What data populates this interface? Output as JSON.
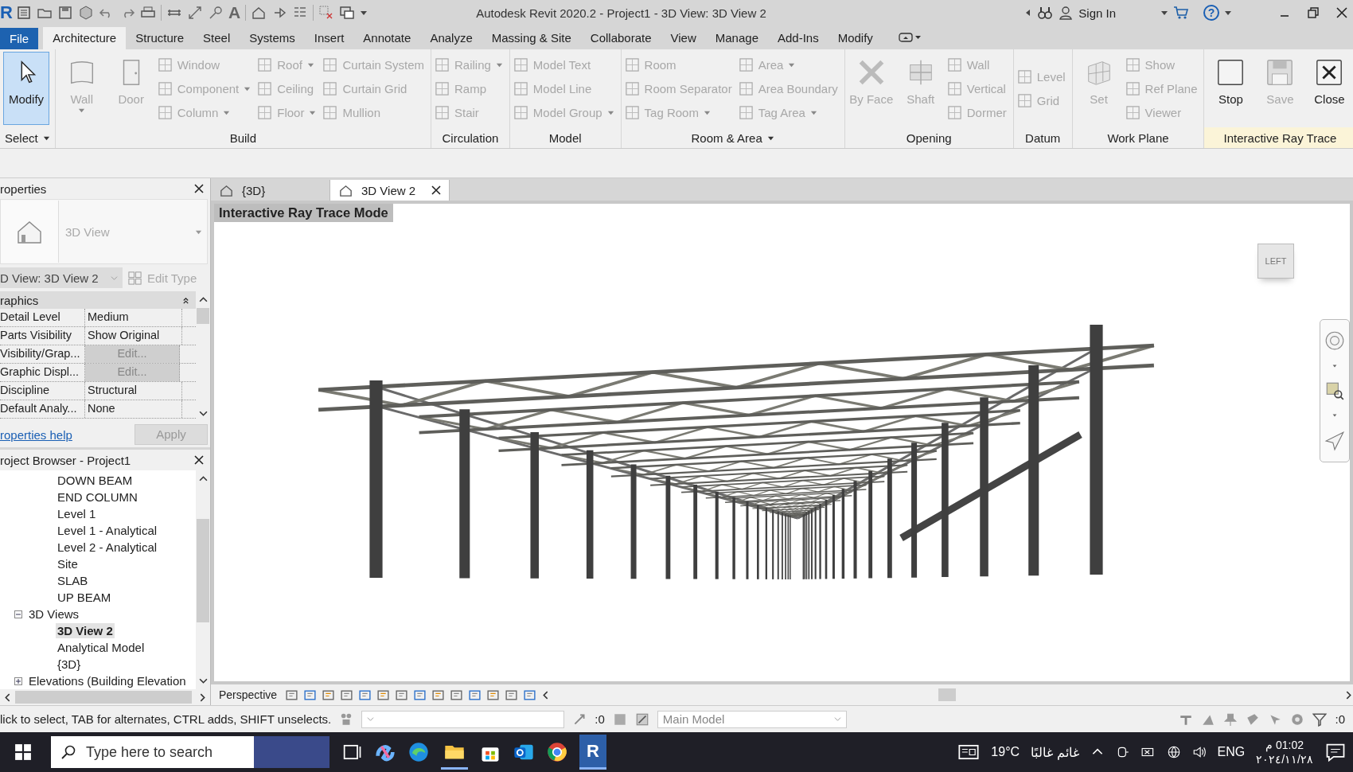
{
  "title_bar": {
    "logo": "R",
    "text_glyph": "A",
    "title": "Autodesk Revit 2020.2 - Project1 - 3D View: 3D View 2",
    "sign_in": "Sign In",
    "help_glyph": "?"
  },
  "ribbon_tabs": [
    {
      "label": "File",
      "kind": "file",
      "selected": false
    },
    {
      "label": "Architecture",
      "kind": "tab",
      "selected": true
    },
    {
      "label": "Structure",
      "kind": "tab",
      "selected": false
    },
    {
      "label": "Steel",
      "kind": "tab",
      "selected": false
    },
    {
      "label": "Systems",
      "kind": "tab",
      "selected": false
    },
    {
      "label": "Insert",
      "kind": "tab",
      "selected": false
    },
    {
      "label": "Annotate",
      "kind": "tab",
      "selected": false
    },
    {
      "label": "Analyze",
      "kind": "tab",
      "selected": false
    },
    {
      "label": "Massing & Site",
      "kind": "tab",
      "selected": false
    },
    {
      "label": "Collaborate",
      "kind": "tab",
      "selected": false
    },
    {
      "label": "View",
      "kind": "tab",
      "selected": false
    },
    {
      "label": "Manage",
      "kind": "tab",
      "selected": false
    },
    {
      "label": "Add-Ins",
      "kind": "tab",
      "selected": false
    },
    {
      "label": "Modify",
      "kind": "tab",
      "selected": false
    }
  ],
  "ribbon_panels": [
    {
      "title": "Select",
      "has_menu": true,
      "highlighted": false,
      "columns": [
        [
          {
            "label": "Modify",
            "kind": "large",
            "selected": true,
            "disabled": false,
            "has_menu": false
          }
        ]
      ]
    },
    {
      "title": "Build",
      "has_menu": false,
      "highlighted": false,
      "columns": [
        [
          {
            "label": "Wall",
            "kind": "large",
            "selected": false,
            "disabled": true,
            "has_menu": true
          }
        ],
        [
          {
            "label": "Door",
            "kind": "large",
            "selected": false,
            "disabled": true,
            "has_menu": false
          }
        ],
        [
          {
            "label": "Window",
            "kind": "small",
            "selected": false,
            "disabled": true,
            "has_menu": false
          },
          {
            "label": "Component",
            "kind": "small",
            "selected": false,
            "disabled": true,
            "has_menu": true
          },
          {
            "label": "Column",
            "kind": "small",
            "selected": false,
            "disabled": true,
            "has_menu": true
          }
        ],
        [
          {
            "label": "Roof",
            "kind": "small",
            "selected": false,
            "disabled": true,
            "has_menu": true
          },
          {
            "label": "Ceiling",
            "kind": "small",
            "selected": false,
            "disabled": true,
            "has_menu": false
          },
          {
            "label": "Floor",
            "kind": "small",
            "selected": false,
            "disabled": true,
            "has_menu": true
          }
        ],
        [
          {
            "label": "Curtain System",
            "kind": "small",
            "selected": false,
            "disabled": true,
            "has_menu": false
          },
          {
            "label": "Curtain Grid",
            "kind": "small",
            "selected": false,
            "disabled": true,
            "has_menu": false
          },
          {
            "label": "Mullion",
            "kind": "small",
            "selected": false,
            "disabled": true,
            "has_menu": false
          }
        ]
      ]
    },
    {
      "title": "Circulation",
      "has_menu": false,
      "highlighted": false,
      "columns": [
        [
          {
            "label": "Railing",
            "kind": "small",
            "selected": false,
            "disabled": true,
            "has_menu": true
          },
          {
            "label": "Ramp",
            "kind": "small",
            "selected": false,
            "disabled": true,
            "has_menu": false
          },
          {
            "label": "Stair",
            "kind": "small",
            "selected": false,
            "disabled": true,
            "has_menu": false
          }
        ]
      ]
    },
    {
      "title": "Model",
      "has_menu": false,
      "highlighted": false,
      "columns": [
        [
          {
            "label": "Model Text",
            "kind": "small",
            "selected": false,
            "disabled": true,
            "has_menu": false
          },
          {
            "label": "Model Line",
            "kind": "small",
            "selected": false,
            "disabled": true,
            "has_menu": false
          },
          {
            "label": "Model Group",
            "kind": "small",
            "selected": false,
            "disabled": true,
            "has_menu": true
          }
        ]
      ]
    },
    {
      "title": "Room & Area",
      "has_menu": true,
      "highlighted": false,
      "columns": [
        [
          {
            "label": "Room",
            "kind": "small",
            "selected": false,
            "disabled": true,
            "has_menu": false
          },
          {
            "label": "Room Separator",
            "kind": "small",
            "selected": false,
            "disabled": true,
            "has_menu": false
          },
          {
            "label": "Tag Room",
            "kind": "small",
            "selected": false,
            "disabled": true,
            "has_menu": true
          }
        ],
        [
          {
            "label": "Area",
            "kind": "small",
            "selected": false,
            "disabled": true,
            "has_menu": true
          },
          {
            "label": "Area Boundary",
            "kind": "small",
            "selected": false,
            "disabled": true,
            "has_menu": false
          },
          {
            "label": "Tag Area",
            "kind": "small",
            "selected": false,
            "disabled": true,
            "has_menu": true
          }
        ]
      ]
    },
    {
      "title": "Opening",
      "has_menu": false,
      "highlighted": false,
      "columns": [
        [
          {
            "label": "By Face",
            "kind": "large",
            "selected": false,
            "disabled": true,
            "has_menu": false
          }
        ],
        [
          {
            "label": "Shaft",
            "kind": "large",
            "selected": false,
            "disabled": true,
            "has_menu": false
          }
        ],
        [
          {
            "label": "Wall",
            "kind": "small",
            "selected": false,
            "disabled": true,
            "has_menu": false
          },
          {
            "label": "Vertical",
            "kind": "small",
            "selected": false,
            "disabled": true,
            "has_menu": false
          },
          {
            "label": "Dormer",
            "kind": "small",
            "selected": false,
            "disabled": true,
            "has_menu": false
          }
        ]
      ]
    },
    {
      "title": "Datum",
      "has_menu": false,
      "highlighted": false,
      "columns": [
        [
          {
            "label": "Level",
            "kind": "small",
            "selected": false,
            "disabled": true,
            "has_menu": false
          },
          {
            "label": "Grid",
            "kind": "small",
            "selected": false,
            "disabled": true,
            "has_menu": false
          }
        ]
      ]
    },
    {
      "title": "Work Plane",
      "has_menu": false,
      "highlighted": false,
      "columns": [
        [
          {
            "label": "Set",
            "kind": "large",
            "selected": false,
            "disabled": true,
            "has_menu": false
          }
        ],
        [
          {
            "label": "Show",
            "kind": "small",
            "selected": false,
            "disabled": true,
            "has_menu": false
          },
          {
            "label": "Ref Plane",
            "kind": "small",
            "selected": false,
            "disabled": true,
            "has_menu": false
          },
          {
            "label": "Viewer",
            "kind": "small",
            "selected": false,
            "disabled": true,
            "has_menu": false
          }
        ]
      ]
    },
    {
      "title": "Interactive Ray Trace",
      "has_menu": false,
      "highlighted": true,
      "columns": [
        [
          {
            "label": "Stop",
            "kind": "large",
            "selected": false,
            "disabled": false,
            "has_menu": false
          }
        ],
        [
          {
            "label": "Save",
            "kind": "large",
            "selected": false,
            "disabled": true,
            "has_menu": false
          }
        ],
        [
          {
            "label": "Close",
            "kind": "large",
            "selected": false,
            "disabled": false,
            "has_menu": false
          }
        ]
      ]
    }
  ],
  "properties": {
    "title": "roperties",
    "type_name": "3D View",
    "instance_selector": "D View: 3D View 2",
    "edit_type": "Edit Type",
    "group": "raphics",
    "rows": [
      {
        "name": "Detail Level",
        "value": "Medium",
        "kind": "text"
      },
      {
        "name": "Parts Visibility",
        "value": "Show Original",
        "kind": "text"
      },
      {
        "name": "Visibility/Grap...",
        "value": "Edit...",
        "kind": "button"
      },
      {
        "name": "Graphic Displ...",
        "value": "Edit...",
        "kind": "button"
      },
      {
        "name": "Discipline",
        "value": "Structural",
        "kind": "text"
      },
      {
        "name": "Default Analy...",
        "value": "None",
        "kind": "text"
      }
    ],
    "help_link": "roperties help",
    "apply": {
      "label": "Apply",
      "disabled": true
    }
  },
  "project_browser": {
    "title": "roject Browser - Project1",
    "tree": [
      {
        "kind": "continued",
        "children": [
          {
            "label": "DOWN BEAM",
            "selected": false
          },
          {
            "label": "END COLUMN",
            "selected": false
          },
          {
            "label": "Level 1",
            "selected": false
          },
          {
            "label": "Level 1 - Analytical",
            "selected": false
          },
          {
            "label": "Level 2 - Analytical",
            "selected": false
          },
          {
            "label": "Site",
            "selected": false
          },
          {
            "label": "SLAB",
            "selected": false
          },
          {
            "label": "UP BEAM",
            "selected": false
          }
        ]
      },
      {
        "kind": "node",
        "label": "3D Views",
        "expanded": true,
        "children": [
          {
            "label": "3D View 2",
            "selected": true
          },
          {
            "label": "Analytical Model",
            "selected": false
          },
          {
            "label": "{3D}",
            "selected": false
          }
        ]
      },
      {
        "kind": "node",
        "label": "Elevations (Building Elevation",
        "expanded": false
      }
    ]
  },
  "view_tabs": [
    {
      "label": "{3D}",
      "selected": false
    },
    {
      "label": "3D View 2",
      "selected": true
    }
  ],
  "viewport": {
    "banner": "Interactive Ray Trace Mode",
    "view_cube": "LEFT"
  },
  "view_controls": {
    "label": "Perspective"
  },
  "status_bar": {
    "message": "lick to select, TAB for alternates, CTRL adds, SHIFT unselects.",
    "workset_count": ":0",
    "design_option": "Main Model",
    "filter_count": ":0"
  },
  "taskbar": {
    "search_placeholder": "Type here to search",
    "revit_glyph": "R",
    "temperature": "19°C",
    "weather": "غائم غالبًا",
    "language": "ENG",
    "time": "01:02 م",
    "date": "٢٠٢٤/١١/٢٨"
  }
}
